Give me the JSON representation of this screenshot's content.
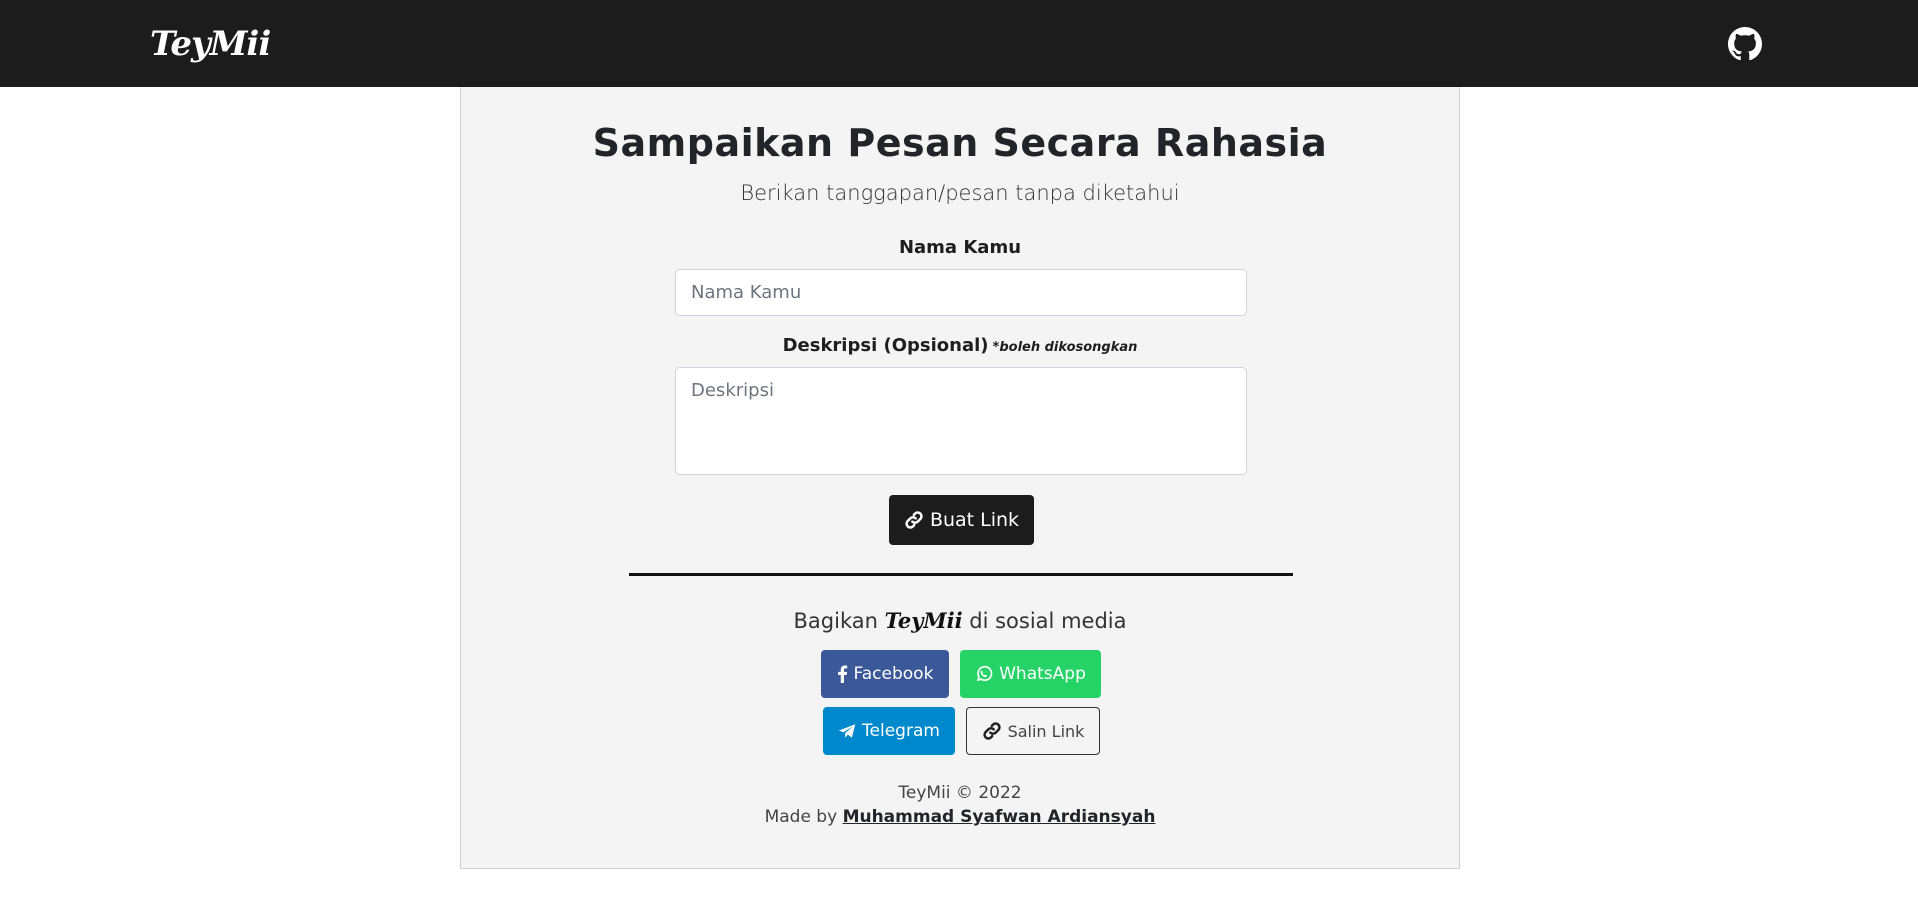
{
  "navbar": {
    "brand": "TeyMii",
    "github_icon": "github-icon"
  },
  "main": {
    "title": "Sampaikan Pesan Secara Rahasia",
    "subtitle": "Berikan tanggapan/pesan tanpa diketahui",
    "name_label": "Nama Kamu",
    "name_placeholder": "Nama Kamu",
    "name_value": "",
    "desc_label": "Deskripsi (Opsional)",
    "desc_hint": "*boleh dikosongkan",
    "desc_placeholder": "Deskripsi",
    "desc_value": "",
    "create_button": {
      "label": "Buat Link",
      "icon": "link-icon"
    }
  },
  "share": {
    "text_prefix": "Bagikan",
    "brand": "TeyMii",
    "text_suffix": "di sosial media",
    "buttons": [
      {
        "label": "Facebook",
        "icon": "facebook-icon",
        "color": "#3b5998"
      },
      {
        "label": "WhatsApp",
        "icon": "whatsapp-icon",
        "color": "#25d366"
      },
      {
        "label": "Telegram",
        "icon": "telegram-icon",
        "color": "#0088cc"
      },
      {
        "label": "Salin Link",
        "icon": "link-icon",
        "color": "#333333"
      }
    ]
  },
  "footer": {
    "copyright": "TeyMii © 2022",
    "made_by_prefix": "Made by",
    "author": "Muhammad Syafwan Ardiansyah"
  },
  "colors": {
    "navbar_bg": "#1c1c1c",
    "card_bg": "#f4f4f4",
    "primary_button": "#1c1c1c"
  }
}
